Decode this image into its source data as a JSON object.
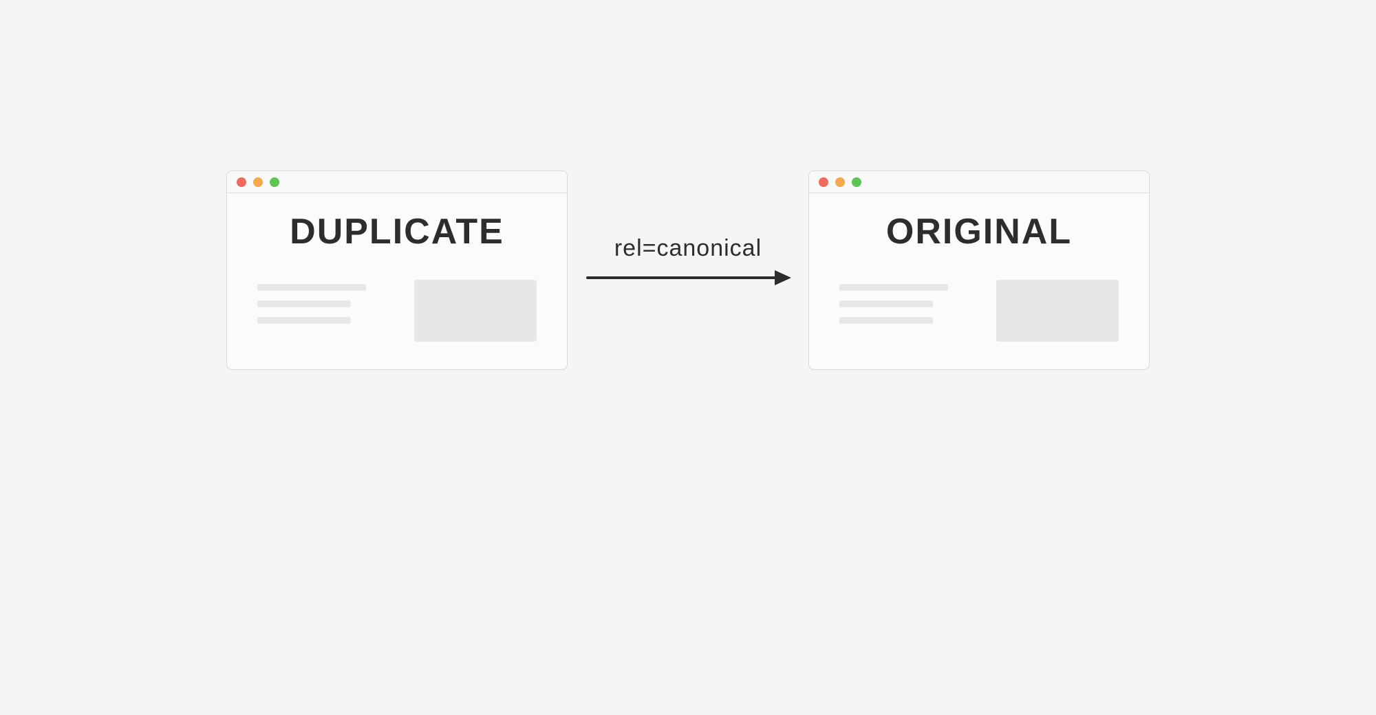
{
  "left_window": {
    "title": "DUPLICATE",
    "traffic_light_colors": {
      "close": "#f06b5d",
      "minimize": "#f5a84d",
      "zoom": "#5dc653"
    }
  },
  "right_window": {
    "title": "ORIGINAL",
    "traffic_light_colors": {
      "close": "#f06b5d",
      "minimize": "#f5a84d",
      "zoom": "#5dc653"
    }
  },
  "connector": {
    "label": "rel=canonical",
    "direction": "left-to-right"
  },
  "colors": {
    "background": "#f4f5f7",
    "window_border": "#d5d7da",
    "placeholder": "#e6e7e9",
    "text": "#2d2d2d"
  }
}
